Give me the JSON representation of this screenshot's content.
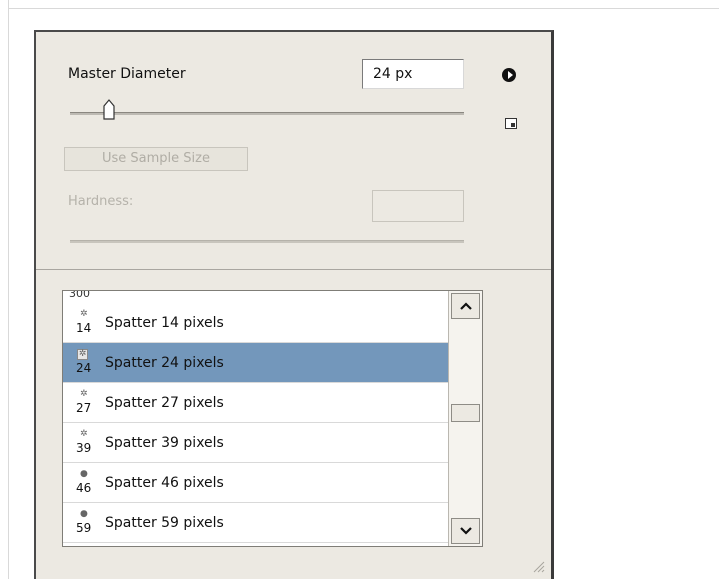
{
  "brush_panel": {
    "master_diameter_label": "Master Diameter",
    "diameter_value": "24 px",
    "diameter_slider_fraction": 0.1,
    "use_sample_size_label": "Use Sample Size",
    "hardness_label": "Hardness:",
    "hardness_value": ""
  },
  "brush_list": {
    "cut_off_label": "300",
    "items": [
      {
        "size": "14",
        "label": "Spatter 14 pixels",
        "selected": false
      },
      {
        "size": "24",
        "label": "Spatter 24 pixels",
        "selected": true
      },
      {
        "size": "27",
        "label": "Spatter 27 pixels",
        "selected": false
      },
      {
        "size": "39",
        "label": "Spatter 39 pixels",
        "selected": false
      },
      {
        "size": "46",
        "label": "Spatter 46 pixels",
        "selected": false
      },
      {
        "size": "59",
        "label": "Spatter 59 pixels",
        "selected": false
      }
    ],
    "selection_color": "#7397bb"
  },
  "icons": {
    "menu": "panel-menu-arrow-icon",
    "new_preset": "new-preset-icon",
    "scroll_up": "chevron-up-icon",
    "scroll_down": "chevron-down-icon",
    "resize": "resize-grip-icon"
  }
}
